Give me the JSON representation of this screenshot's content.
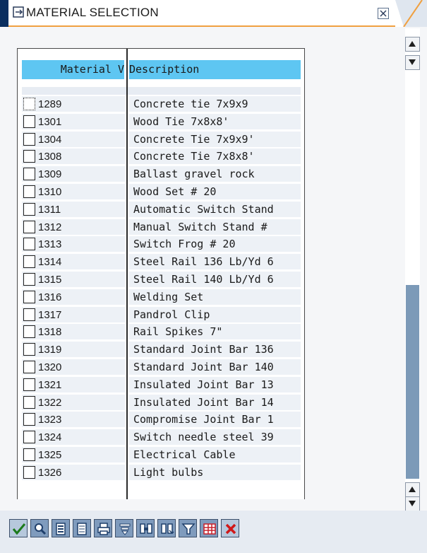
{
  "window": {
    "title": "MATERIAL SELECTION"
  },
  "columns": {
    "material": "Material V",
    "description": "Description"
  },
  "rows": [
    {
      "material": "1289",
      "description": "Concrete tie 7x9x9"
    },
    {
      "material": "1301",
      "description": "Wood Tie 7x8x8'"
    },
    {
      "material": "1304",
      "description": "Concrete Tie 7x9x9'"
    },
    {
      "material": "1308",
      "description": "Concrete Tie 7x8x8'"
    },
    {
      "material": "1309",
      "description": "Ballast gravel rock"
    },
    {
      "material": "1310",
      "description": "Wood Set # 20"
    },
    {
      "material": "1311",
      "description": "Automatic Switch Stand"
    },
    {
      "material": "1312",
      "description": "Manual Switch Stand #"
    },
    {
      "material": "1313",
      "description": "Switch Frog # 20"
    },
    {
      "material": "1314",
      "description": "Steel Rail 136 Lb/Yd 6"
    },
    {
      "material": "1315",
      "description": "Steel Rail 140 Lb/Yd 6"
    },
    {
      "material": "1316",
      "description": "Welding Set"
    },
    {
      "material": "1317",
      "description": "Pandrol Clip"
    },
    {
      "material": "1318",
      "description": "Rail Spikes 7\""
    },
    {
      "material": "1319",
      "description": "Standard Joint Bar 136"
    },
    {
      "material": "1320",
      "description": "Standard Joint Bar 140"
    },
    {
      "material": "1321",
      "description": "Insulated Joint Bar 13"
    },
    {
      "material": "1322",
      "description": "Insulated Joint Bar 14"
    },
    {
      "material": "1323",
      "description": "Compromise Joint Bar 1"
    },
    {
      "material": "1324",
      "description": "Switch needle steel 39"
    },
    {
      "material": "1325",
      "description": "Electrical Cable"
    },
    {
      "material": "1326",
      "description": "Light bulbs"
    }
  ],
  "toolbar": [
    {
      "name": "continue-icon",
      "color": "#1c7a1c"
    },
    {
      "name": "detail-view-icon",
      "color": "#1f3f6b"
    },
    {
      "name": "select-all-icon",
      "color": "#1f3f6b"
    },
    {
      "name": "deselect-all-icon",
      "color": "#1f3f6b"
    },
    {
      "name": "print-icon",
      "color": "#1f3f6b"
    },
    {
      "name": "sort-icon",
      "color": "#1f3f6b"
    },
    {
      "name": "find-icon",
      "color": "#1f3f6b"
    },
    {
      "name": "find-next-icon",
      "color": "#1f3f6b"
    },
    {
      "name": "filter-icon",
      "color": "#1f3f6b"
    },
    {
      "name": "layout-icon",
      "color": "#c8202a"
    },
    {
      "name": "cancel-icon",
      "color": "#d01818"
    }
  ],
  "colors": {
    "header_blue": "#5ec6f2",
    "title_accent": "#f0a040",
    "title_leftbar": "#0a2e5f",
    "scroll_thumb": "#7c9ab8",
    "cell_bg": "#edf1f6"
  },
  "scrollbar": {
    "thumb_position_fraction": 0.52,
    "thumb_size_fraction": 0.48
  }
}
